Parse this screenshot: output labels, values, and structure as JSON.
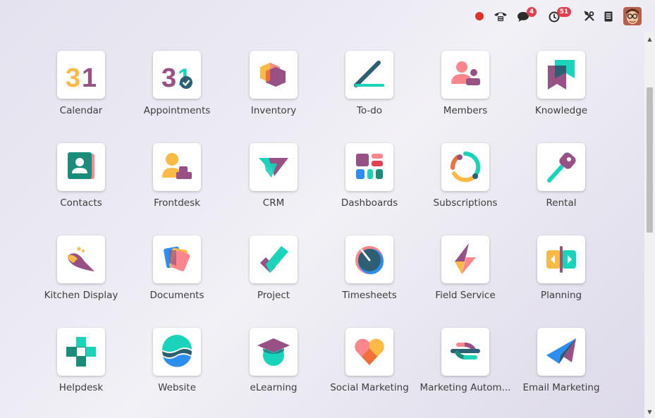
{
  "topbar": {
    "icons": [
      "record-dot-icon",
      "phone-icon",
      "chat-icon",
      "clock-icon",
      "tools-icon",
      "document-icon",
      "avatar"
    ],
    "chat_badge": "4",
    "activity_badge": "51"
  },
  "apps": [
    {
      "label": "Calendar",
      "icon": "calendar-icon"
    },
    {
      "label": "Appointments",
      "icon": "appointments-icon"
    },
    {
      "label": "Inventory",
      "icon": "inventory-icon"
    },
    {
      "label": "To-do",
      "icon": "todo-icon"
    },
    {
      "label": "Members",
      "icon": "members-icon"
    },
    {
      "label": "Knowledge",
      "icon": "knowledge-icon"
    },
    {
      "label": "Contacts",
      "icon": "contacts-icon"
    },
    {
      "label": "Frontdesk",
      "icon": "frontdesk-icon"
    },
    {
      "label": "CRM",
      "icon": "crm-icon"
    },
    {
      "label": "Dashboards",
      "icon": "dashboards-icon"
    },
    {
      "label": "Subscriptions",
      "icon": "subscriptions-icon"
    },
    {
      "label": "Rental",
      "icon": "rental-icon"
    },
    {
      "label": "Kitchen Display",
      "icon": "kitchen-display-icon"
    },
    {
      "label": "Documents",
      "icon": "documents-icon"
    },
    {
      "label": "Project",
      "icon": "project-icon"
    },
    {
      "label": "Timesheets",
      "icon": "timesheets-icon"
    },
    {
      "label": "Field Service",
      "icon": "field-service-icon"
    },
    {
      "label": "Planning",
      "icon": "planning-icon"
    },
    {
      "label": "Helpdesk",
      "icon": "helpdesk-icon"
    },
    {
      "label": "Website",
      "icon": "website-icon"
    },
    {
      "label": "eLearning",
      "icon": "elearning-icon"
    },
    {
      "label": "Social Marketing",
      "icon": "social-marketing-icon"
    },
    {
      "label": "Marketing Autom...",
      "icon": "marketing-automation-icon"
    },
    {
      "label": "Email Marketing",
      "icon": "email-marketing-icon"
    }
  ],
  "colors": {
    "purple": "#985184",
    "teal": "#1ad3bb",
    "orange": "#fc868b",
    "yellow": "#fbb945",
    "red_dot": "#e0322c",
    "badge": "#e3404f"
  }
}
